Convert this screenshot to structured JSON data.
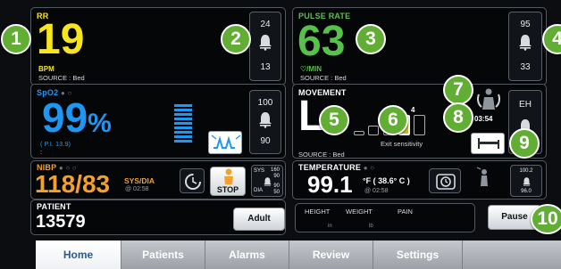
{
  "colors": {
    "rr": "#f7e61b",
    "pulse": "#57c24a",
    "spo2": "#1e96f2",
    "nibp": "#f4a12a",
    "marker": "#62ad34"
  },
  "rr": {
    "label": "RR",
    "value": "19",
    "unit": "BPM",
    "source": "SOURCE : Bed",
    "alarm_high": "24",
    "alarm_low": "13"
  },
  "pulse": {
    "label": "PULSE RATE",
    "value": "63",
    "unit": "♡/MIN",
    "source": "SOURCE : Bed",
    "alarm_high": "95",
    "alarm_low": "33"
  },
  "spo2": {
    "label": "SpO2",
    "value": "99",
    "unit": "%",
    "pi": "( P.I. 13.9)",
    "colon": ":",
    "alarm_high": "100",
    "alarm_low": "90",
    "signal_bars_lit": 9
  },
  "movement": {
    "label": "MOVEMENT",
    "level": "L",
    "sensitivity_value": "4",
    "exit_label": "Exit sensitivity",
    "source": "SOURCE : Bed",
    "timer": "03:54",
    "alarm_label": "EH"
  },
  "nibp": {
    "label": "NIBP",
    "value": "118/83",
    "unit": "SYS/DIA",
    "time": "@ 02:58",
    "stop_label": "STOP",
    "sys_label": "SYS",
    "dia_label": "DIA",
    "limits": [
      "160",
      "90",
      "90",
      "50"
    ]
  },
  "temperature": {
    "label": "TEMPERATURE",
    "value": "99.1",
    "unit_text": "°F ( 38.6° C )",
    "time": "@ 02:58",
    "alarm_high": "100.2",
    "alarm_low": "96.0"
  },
  "patient": {
    "label": "PATIENT",
    "id": "13579",
    "type_button": "Adult"
  },
  "measurements": {
    "height_label": "HEIGHT",
    "weight_label": "WEIGHT",
    "pain_label": "PAIN",
    "height_unit": "in",
    "weight_unit": "lb"
  },
  "pause_button": "Pause",
  "tabs": [
    "Home",
    "Patients",
    "Alarms",
    "Review",
    "Settings"
  ],
  "markers": [
    "1",
    "2",
    "3",
    "4",
    "5",
    "6",
    "7",
    "8",
    "9",
    "10"
  ]
}
